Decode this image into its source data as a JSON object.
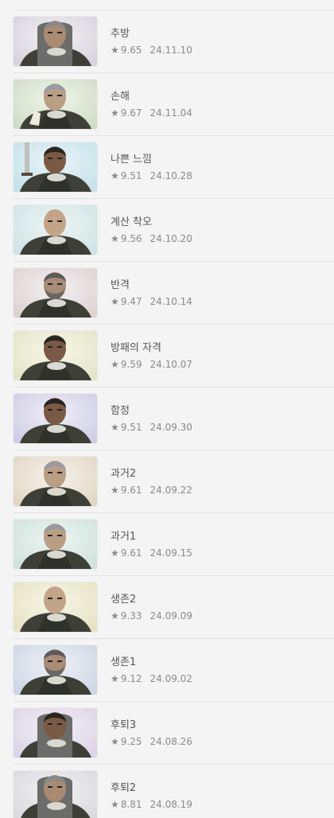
{
  "episodes": [
    {
      "title": "추방",
      "rating": "9.65",
      "date": "24.11.10",
      "bg": [
        "#f2f2f2",
        "#d7d2de"
      ],
      "char": "hooded-pale"
    },
    {
      "title": "손해",
      "rating": "9.67",
      "date": "24.11.04",
      "bg": [
        "#f0f5ea",
        "#cfdcc6"
      ],
      "char": "old-cards"
    },
    {
      "title": "나쁜 느낌",
      "rating": "9.51",
      "date": "24.10.28",
      "bg": [
        "#e9f4f8",
        "#c6e1ea"
      ],
      "char": "sword"
    },
    {
      "title": "계산 착오",
      "rating": "9.56",
      "date": "24.10.20",
      "bg": [
        "#eef6f6",
        "#cfe3e3"
      ],
      "char": "bald-old"
    },
    {
      "title": "반격",
      "rating": "9.47",
      "date": "24.10.14",
      "bg": [
        "#f4f0f0",
        "#ddd2d2"
      ],
      "char": "bearded"
    },
    {
      "title": "방패의 자격",
      "rating": "9.59",
      "date": "24.10.07",
      "bg": [
        "#f6f6e8",
        "#e5e4c8"
      ],
      "char": "dark-young"
    },
    {
      "title": "함정",
      "rating": "9.51",
      "date": "24.09.30",
      "bg": [
        "#efeef7",
        "#cfcde4"
      ],
      "char": "dark-young"
    },
    {
      "title": "과거2",
      "rating": "9.61",
      "date": "24.09.22",
      "bg": [
        "#f6f2ea",
        "#e1d6c4"
      ],
      "char": "old-grey"
    },
    {
      "title": "과거1",
      "rating": "9.61",
      "date": "24.09.15",
      "bg": [
        "#eef5f2",
        "#cfe2db"
      ],
      "char": "old-grey"
    },
    {
      "title": "생존2",
      "rating": "9.33",
      "date": "24.09.09",
      "bg": [
        "#f6f6e6",
        "#e6e2c4"
      ],
      "char": "bald-old"
    },
    {
      "title": "생존1",
      "rating": "9.12",
      "date": "24.09.02",
      "bg": [
        "#eef1f6",
        "#cdd6e4"
      ],
      "char": "bearded"
    },
    {
      "title": "후퇴3",
      "rating": "9.25",
      "date": "24.08.26",
      "bg": [
        "#f3eff6",
        "#dcd3e6"
      ],
      "char": "hooded-dark"
    },
    {
      "title": "후퇴2",
      "rating": "8.81",
      "date": "24.08.19",
      "bg": [
        "#f2f2f2",
        "#d9d9de"
      ],
      "char": "hooded-pale"
    }
  ],
  "colors": {
    "text_title": "#555555",
    "text_meta": "#8a8a8a",
    "divider": "#e2e2e2",
    "background": "#f4f4f4"
  },
  "icons": {
    "rating": "star-icon"
  },
  "star_glyph": "★"
}
